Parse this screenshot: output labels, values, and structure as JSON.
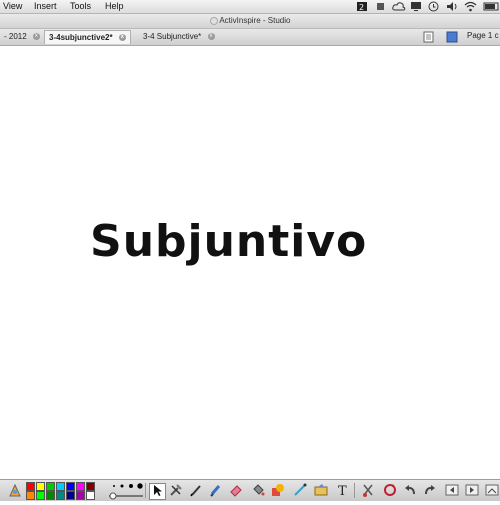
{
  "menubar": {
    "view": "View",
    "insert": "Insert",
    "tools": "Tools",
    "help": "Help"
  },
  "window": {
    "title": "ActivInspire - Studio"
  },
  "tabs": [
    {
      "label": "- 2012"
    },
    {
      "label": "3-4subjunctive2*"
    },
    {
      "label": "3-4 Subjunctive*"
    }
  ],
  "page_indicator": "Page 1 c",
  "canvas": {
    "text": "Subjuntivo"
  },
  "colors": {
    "palette_row1": [
      "#ff0000",
      "#ffff00",
      "#00cc00",
      "#00ccff",
      "#0000ff",
      "#ff00ff",
      "#800000"
    ],
    "palette_row2": [
      "#ff8800",
      "#00ff00",
      "#008800",
      "#008888",
      "#000088",
      "#aa00aa",
      "#ffffff"
    ]
  }
}
